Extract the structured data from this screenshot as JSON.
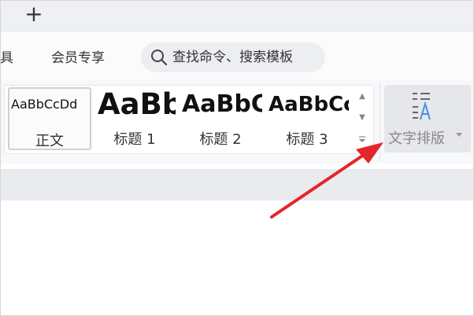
{
  "tabbar": {
    "new_tab_label": "+"
  },
  "menubar": {
    "items": [
      {
        "label": "具"
      },
      {
        "label": "会员专享"
      }
    ],
    "search": {
      "placeholder": "查找命令、搜索模板"
    }
  },
  "ribbon": {
    "styles": [
      {
        "preview": "AaBbCcDd",
        "label": "正文",
        "selected": true
      },
      {
        "preview": "AaBb",
        "label": "标题 1"
      },
      {
        "preview": "AaBbC",
        "label": "标题 2"
      },
      {
        "preview": "AaBbCc",
        "label": "标题 3"
      }
    ],
    "text_layout": {
      "label": "文字排版",
      "icon": "text-layout-icon",
      "accent": "#4a8fe0"
    }
  },
  "annotation": {
    "arrow_color": "#e2262b"
  }
}
